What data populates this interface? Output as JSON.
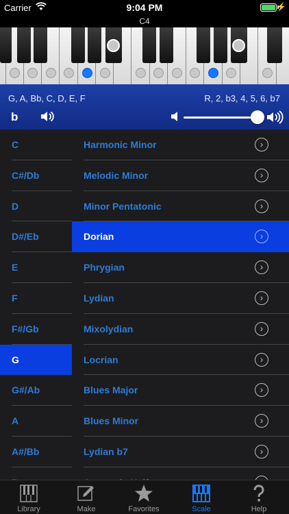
{
  "status": {
    "carrier": "Carrier",
    "time": "9:04 PM"
  },
  "piano": {
    "octave_label": "C4"
  },
  "info": {
    "notes": "G, A, Bb, C, D, E, F",
    "intervals": "R, 2, b3, 4, 5, 6, b7",
    "flat_symbol": "b",
    "volume_level": 0.95
  },
  "keys": {
    "selected": "G",
    "items": [
      "C",
      "C#/Db",
      "D",
      "D#/Eb",
      "E",
      "F",
      "F#/Gb",
      "G",
      "G#/Ab",
      "A",
      "A#/Bb",
      "B"
    ]
  },
  "scales": {
    "selected": "Dorian",
    "items": [
      "Harmonic Minor",
      "Melodic Minor",
      "Minor Pentatonic",
      "Dorian",
      "Phrygian",
      "Lydian",
      "Mixolydian",
      "Locrian",
      "Blues Major",
      "Blues Minor",
      "Lydian b7",
      "Octatonic Half"
    ]
  },
  "tabs": [
    {
      "label": "Library",
      "icon": "library-icon"
    },
    {
      "label": "Make",
      "icon": "make-icon"
    },
    {
      "label": "Favorites",
      "icon": "star-icon"
    },
    {
      "label": "Scale",
      "icon": "scale-icon",
      "active": true
    },
    {
      "label": "Help",
      "icon": "help-icon"
    }
  ],
  "colors": {
    "accent": "#1677ff",
    "selected_row": "#0a3ee0",
    "info_panel": "#1d3fa8"
  }
}
